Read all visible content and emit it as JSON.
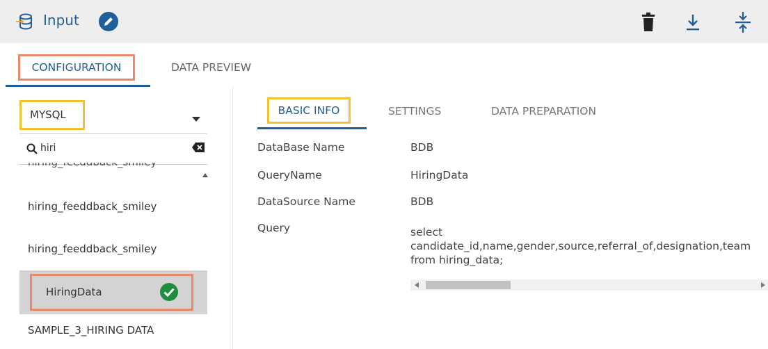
{
  "header": {
    "title": "Input",
    "icons": {
      "database": "database-input-icon",
      "edit": "pencil-icon",
      "delete": "trash-icon",
      "download": "download-icon",
      "collapse": "collapse-vertical-icon"
    }
  },
  "tabs": {
    "configuration": "CONFIGURATION",
    "data_preview": "DATA PREVIEW"
  },
  "left": {
    "source": "MYSQL",
    "search_value": "hiri",
    "list": [
      "hiring_feeddback_smiley",
      "hiring_feeddback_smiley",
      "hiring_feeddback_smiley",
      "HiringData",
      "SAMPLE_3_HIRING DATA"
    ],
    "selected": "HiringData"
  },
  "subtabs": {
    "basic_info": "BASIC INFO",
    "settings": "SETTINGS",
    "data_preparation": "DATA PREPARATION"
  },
  "basic_info": {
    "database_label": "DataBase Name",
    "database_value": "BDB",
    "queryname_label": "QueryName",
    "queryname_value": "HiringData",
    "datasource_label": "DataSource Name",
    "datasource_value": "BDB",
    "query_label": "Query",
    "query_value": "select\ncandidate_id,name,gender,source,referral_of,designation,team\nfrom hiring_data;"
  },
  "colors": {
    "accent": "#1f5f9a",
    "highlight_orange": "#e88a6a",
    "highlight_yellow": "#f2c230",
    "success": "#1e8e3e",
    "header_bg": "#eeeeee"
  }
}
